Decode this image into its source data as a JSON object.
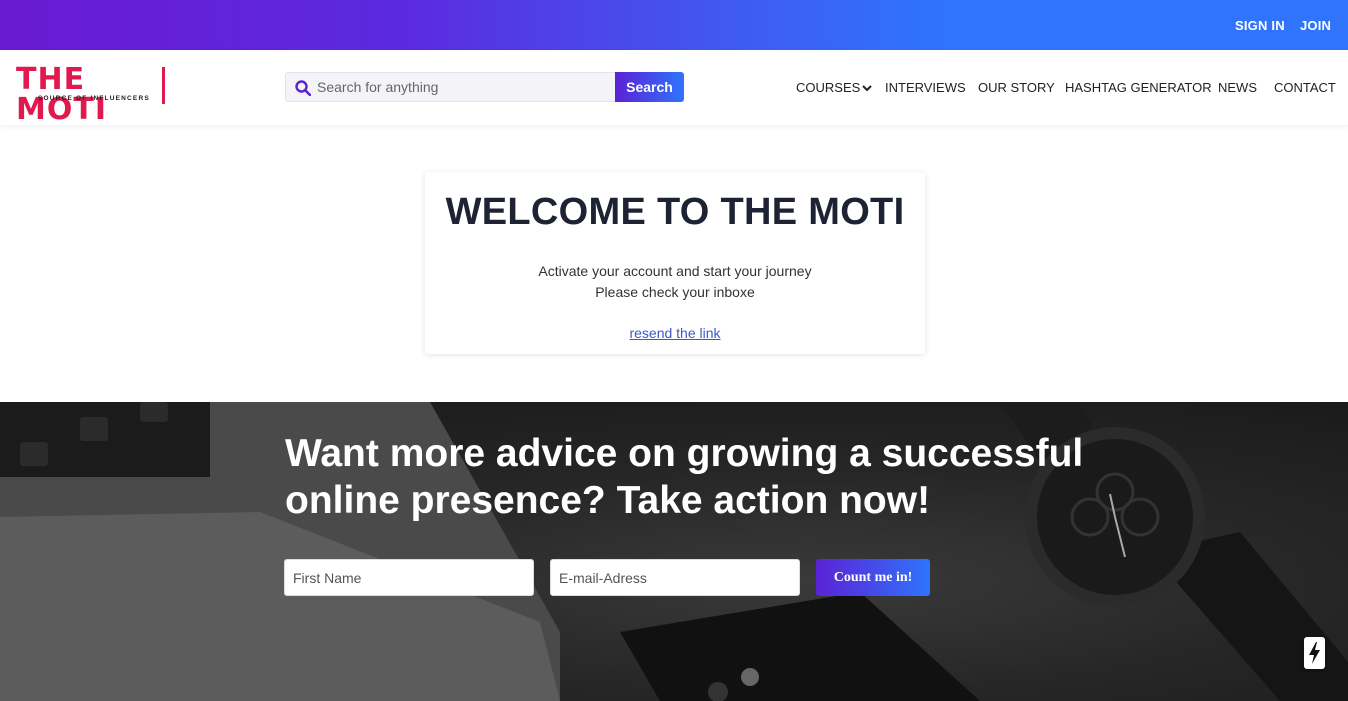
{
  "topbar": {
    "sign_in": "SIGN IN",
    "join": "JOIN"
  },
  "logo": {
    "title": "THE MOTI",
    "subtitle": "SOURCE OF INFLUENCERS"
  },
  "search": {
    "placeholder": "Search for anything",
    "button": "Search"
  },
  "nav": {
    "items": [
      "COURSES",
      "INTERVIEWS",
      "OUR STORY",
      "HASHTAG GENERATOR",
      "NEWS",
      "CONTACT"
    ]
  },
  "card": {
    "title": "WELCOME TO THE MOTI",
    "line1": "Activate your account and start your journey",
    "line2": "Please check your inboxe",
    "link": "resend the link"
  },
  "hero": {
    "heading": "Want more advice on growing a successful online presence? Take action now!",
    "first_name_placeholder": "First Name",
    "email_placeholder": "E-mail-Adress",
    "cta": "Count me in!"
  },
  "icons": {
    "search": "search-icon",
    "chevron": "chevron-down-icon",
    "bolt": "lightning-icon"
  },
  "colors": {
    "brand": "#e01a4f",
    "gradient_start": "#6a1ad1",
    "gradient_end": "#2f74fb"
  }
}
